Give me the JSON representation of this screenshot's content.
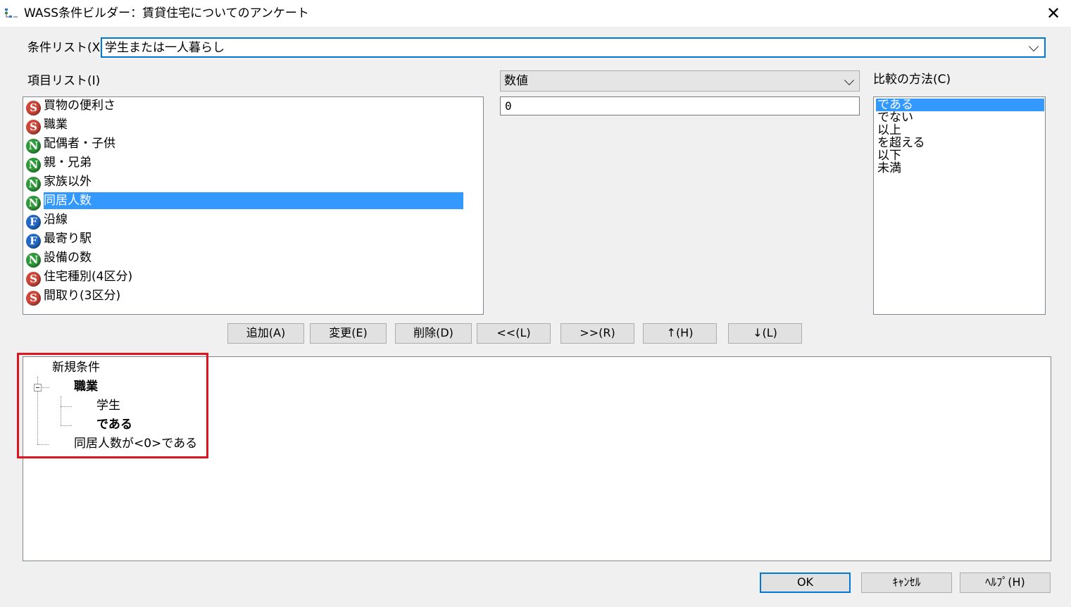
{
  "window": {
    "title": "WASS条件ビルダー：賃貸住宅についてのアンケート",
    "close_glyph": "✕"
  },
  "condition_list": {
    "label": "条件リスト(X)",
    "value": "学生または一人暮らし"
  },
  "item_list": {
    "label": "項目リスト(I)",
    "items": [
      {
        "type": "S",
        "label": "買物の便利さ"
      },
      {
        "type": "S",
        "label": "職業"
      },
      {
        "type": "N",
        "label": "配偶者・子供"
      },
      {
        "type": "N",
        "label": "親・兄弟"
      },
      {
        "type": "N",
        "label": "家族以外"
      },
      {
        "type": "N",
        "label": "同居人数",
        "selected": true
      },
      {
        "type": "F",
        "label": "沿線"
      },
      {
        "type": "F",
        "label": "最寄り駅"
      },
      {
        "type": "N",
        "label": "設備の数"
      },
      {
        "type": "S",
        "label": "住宅種別(4区分)"
      },
      {
        "type": "S",
        "label": "間取り(3区分)"
      }
    ]
  },
  "value_type": {
    "selected": "数値"
  },
  "value_input": {
    "value": "0"
  },
  "compare": {
    "label": "比較の方法(C)",
    "options": [
      "である",
      "でない",
      "以上",
      "を超える",
      "以下",
      "未満"
    ],
    "selected_index": 0
  },
  "actions": {
    "add": "追加(A)",
    "change": "変更(E)",
    "delete": "削除(D)",
    "left": "<<(L)",
    "right": ">>(R)",
    "up": "↑(H)",
    "down": "↓(L)"
  },
  "tree": {
    "root": "新規条件",
    "group": "職業",
    "group_value": "学生",
    "group_op": "である",
    "leaf": "同居人数が<0>である"
  },
  "footer": {
    "ok": "OK",
    "cancel": "ｷｬﾝｾﾙ",
    "help": "ﾍﾙﾌﾟ(H)"
  },
  "colors": {
    "selection": "#3399ff",
    "focus_border": "#0078d7",
    "highlight_box": "#e0141e"
  }
}
